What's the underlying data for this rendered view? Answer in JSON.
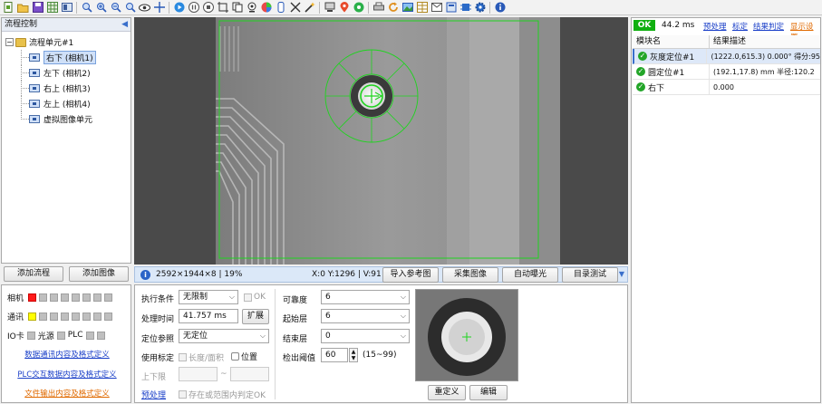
{
  "toolbar": {
    "icons": [
      "new-icon",
      "open-icon",
      "save-icon",
      "grid-icon",
      "layout-icon",
      "search-icon",
      "zoom-in-icon",
      "zoom-out-icon",
      "zoom-fit-icon",
      "eye-icon",
      "crosshair-icon",
      "play-icon",
      "pause-icon",
      "stop-icon",
      "roi-icon",
      "copy-icon",
      "camera-icon",
      "color-icon",
      "calib-icon",
      "transform-icon",
      "magic-icon",
      "network-icon",
      "location-icon",
      "settings-green-icon",
      "printer-icon",
      "refresh-icon",
      "image-icon",
      "table-icon",
      "email-icon",
      "archive-icon",
      "chip-icon",
      "gear-icon",
      "info-icon"
    ]
  },
  "left_panel": {
    "title": "流程控制",
    "root": "流程单元#1",
    "items": [
      "右下 (相机1)",
      "左下 (相机2)",
      "右上 (相机3)",
      "左上 (相机4)",
      "虚拟图像单元"
    ],
    "add_flow": "添加流程",
    "add_image": "添加图像"
  },
  "status": {
    "camera_label": "相机",
    "comm_label": "通讯",
    "io_label": "IO卡",
    "light_label": "光源",
    "plc_label": "PLC",
    "link1": "数据通讯内容及格式定义",
    "link2": "PLC交互数据内容及格式定义",
    "link3": "文件输出内容及格式定义"
  },
  "infobar": {
    "info": "2592×1944×8 | 19%",
    "coords": "X:0 Y:1296 | V:91",
    "btn_import": "导入参考图",
    "btn_capture": "采集图像",
    "btn_exposure": "自动曝光",
    "btn_dirtest": "目录测试"
  },
  "params": {
    "exec_label": "执行条件",
    "exec_value": "无限制",
    "ok_label": "OK",
    "time_label": "处理时间",
    "time_value": "41.757 ms",
    "expand_btn": "扩展",
    "ref_label": "定位参照",
    "ref_value": "无定位",
    "calib_label": "使用标定",
    "length_label": "长度/面积",
    "position_label": "位置",
    "limit_label": "上下限",
    "tilde": "~",
    "preproc_link": "预处理",
    "range_label": "存在或范围内判定OK",
    "sim_label": "可靠度",
    "sim_value": "6",
    "start_label": "起始层",
    "start_value": "6",
    "end_label": "结束层",
    "end_value": "0",
    "thresh_label": "检出阈值",
    "thresh_value": "60",
    "thresh_range": "(15~99)",
    "redefine_btn": "重定义",
    "edit_btn": "编辑"
  },
  "right_panel": {
    "ok": "OK",
    "time": "44.2 ms",
    "link_preproc": "预处理",
    "link_calib": "标定",
    "link_result": "结果判定",
    "link_display": "显示设置",
    "col1": "模块名",
    "col2": "结果描述",
    "rows": [
      {
        "name": "灰度定位#1",
        "desc": "(1222.0,615.3) 0.000° 得分:95"
      },
      {
        "name": "圆定位#1",
        "desc": "(192.1,17.8) mm 半径:120.2"
      },
      {
        "name": "右下",
        "desc": "0.000"
      }
    ]
  }
}
